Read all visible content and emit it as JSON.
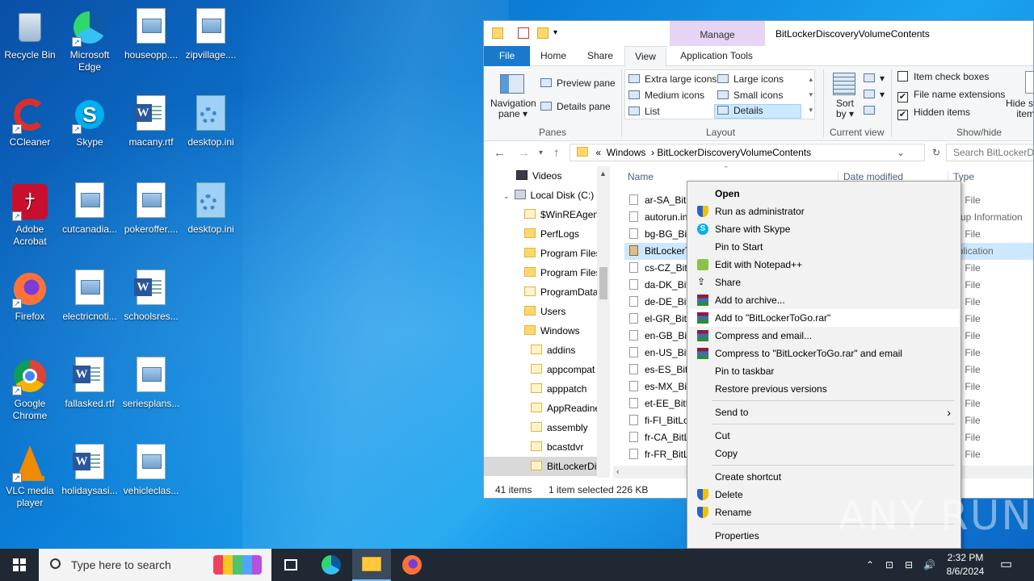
{
  "desktop": {
    "icons": [
      {
        "label": "Recycle Bin"
      },
      {
        "label": "Microsoft Edge"
      },
      {
        "label": "houseopp...."
      },
      {
        "label": "zipvillage...."
      },
      {
        "label": "CCleaner"
      },
      {
        "label": "Skype"
      },
      {
        "label": "macany.rtf"
      },
      {
        "label": "desktop.ini"
      },
      {
        "label": "Adobe Acrobat"
      },
      {
        "label": "cutcanadia..."
      },
      {
        "label": "pokeroffer...."
      },
      {
        "label": "desktop.ini"
      },
      {
        "label": "Firefox"
      },
      {
        "label": "electricnoti..."
      },
      {
        "label": "schoolsres..."
      },
      {
        "label": "Google Chrome"
      },
      {
        "label": "fallasked.rtf"
      },
      {
        "label": "seriesplans..."
      },
      {
        "label": "VLC media player"
      },
      {
        "label": "holidaysasi..."
      },
      {
        "label": "vehicleclas..."
      }
    ]
  },
  "explorer": {
    "title": "BitLockerDiscoveryVolumeContents",
    "manage_tab": "Manage",
    "tabs": [
      "File",
      "Home",
      "Share",
      "View",
      "Application Tools"
    ],
    "ribbon": {
      "navigation_pane": "Navigation pane",
      "preview_pane": "Preview pane",
      "details_pane": "Details pane",
      "panes_label": "Panes",
      "layout_options": [
        "Extra large icons",
        "Large icons",
        "Medium icons",
        "Small icons",
        "List",
        "Details"
      ],
      "layout_label": "Layout",
      "sort_by": "Sort by",
      "current_view_label": "Current view",
      "item_check_boxes": "Item check boxes",
      "file_name_extensions": "File name extensions",
      "hidden_items": "Hidden items",
      "show_hide_label": "Show/hide",
      "hide_selected": "Hide se",
      "hide_selected_2": "item"
    },
    "address": {
      "prefix": "«",
      "crumbs": [
        "Windows",
        "BitLockerDiscoveryVolumeContents"
      ],
      "search_placeholder": "Search BitLockerDis"
    },
    "nav_items": [
      {
        "label": "Videos"
      },
      {
        "label": "Local Disk (C:)"
      },
      {
        "label": "$WinREAgent"
      },
      {
        "label": "PerfLogs"
      },
      {
        "label": "Program Files"
      },
      {
        "label": "Program Files"
      },
      {
        "label": "ProgramData"
      },
      {
        "label": "Users"
      },
      {
        "label": "Windows"
      },
      {
        "label": "addins"
      },
      {
        "label": "appcompat"
      },
      {
        "label": "apppatch"
      },
      {
        "label": "AppReadine"
      },
      {
        "label": "assembly"
      },
      {
        "label": "bcastdvr"
      },
      {
        "label": "BitLockerDi"
      }
    ],
    "columns": {
      "name": "Name",
      "date": "Date modified",
      "type": "Type"
    },
    "files": [
      {
        "name": "ar-SA_BitL",
        "type": "UI File"
      },
      {
        "name": "autorun.in",
        "type": "etup Information"
      },
      {
        "name": "bg-BG_Bit",
        "type": "UI File"
      },
      {
        "name": "BitLockerT",
        "type": "pplication"
      },
      {
        "name": "cs-CZ_BitL",
        "type": "UI File"
      },
      {
        "name": "da-DK_Bit",
        "type": "UI File"
      },
      {
        "name": "de-DE_Bit",
        "type": "UI File"
      },
      {
        "name": "el-GR_BitL",
        "type": "UI File"
      },
      {
        "name": "en-GB_Bit",
        "type": "UI File"
      },
      {
        "name": "en-US_Bitl",
        "type": "UI File"
      },
      {
        "name": "es-ES_BitL",
        "type": "UI File"
      },
      {
        "name": "es-MX_Bit",
        "type": "UI File"
      },
      {
        "name": "et-EE_BitL",
        "type": "UI File"
      },
      {
        "name": "fi-FI_BitLo",
        "type": "UI File"
      },
      {
        "name": "fr-CA_BitL",
        "type": "UI File"
      },
      {
        "name": "fr-FR_BitL",
        "type": "UI File"
      }
    ],
    "status": {
      "count": "41 items",
      "selected": "1 item selected",
      "size": "226 KB"
    }
  },
  "context_menu": {
    "items": [
      {
        "label": "Open"
      },
      {
        "label": "Run as administrator"
      },
      {
        "label": "Share with Skype"
      },
      {
        "label": "Pin to Start"
      },
      {
        "label": "Edit with Notepad++"
      },
      {
        "label": "Share"
      },
      {
        "label": "Add to archive..."
      },
      {
        "label": "Add to \"BitLockerToGo.rar\""
      },
      {
        "label": "Compress and email..."
      },
      {
        "label": "Compress to \"BitLockerToGo.rar\" and email"
      },
      {
        "label": "Pin to taskbar"
      },
      {
        "label": "Restore previous versions"
      },
      {
        "label": "Send to"
      },
      {
        "label": "Cut"
      },
      {
        "label": "Copy"
      },
      {
        "label": "Create shortcut"
      },
      {
        "label": "Delete"
      },
      {
        "label": "Rename"
      },
      {
        "label": "Properties"
      }
    ]
  },
  "taskbar": {
    "search_placeholder": "Type here to search",
    "time": "2:32 PM",
    "date": "8/6/2024"
  },
  "watermark": "ANY RUN"
}
